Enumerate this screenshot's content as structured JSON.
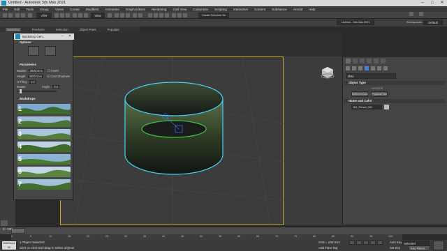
{
  "window": {
    "title": "Untitled - Autodesk 3ds Max 2021",
    "minimize": "–",
    "maximize": "□",
    "close": "✕"
  },
  "menu": [
    "File",
    "Edit",
    "Tools",
    "Group",
    "Views",
    "Create",
    "Modifiers",
    "Animation",
    "Graph Editors",
    "Rendering",
    "Civil View",
    "Customize",
    "Scripting",
    "Interactive",
    "Content",
    "Substance",
    "Arnold",
    "Help"
  ],
  "toolbar": {
    "view_dropdown": "View",
    "selection_set": "Create Selection Se",
    "user_box": "Libertos - 3ds Max 2021",
    "workspaces_label": "Workspaces:",
    "workspace_value": "Default"
  },
  "tabs": [
    "Modeling",
    "Freeform",
    "Selection",
    "Object Paint",
    "Populate"
  ],
  "viewport": {
    "label": "[+] [T",
    "accent": "#c9a623"
  },
  "float_panel": {
    "title": "Backdrop Gen...",
    "options_label": "Options",
    "parameters_label": "Parameters",
    "radius_label": "Radius",
    "radius_value": "3000.0cm",
    "invert_label": "Invert",
    "height_label": "Height",
    "height_value": "3000.0cm",
    "cast_shadows_label": "Cast Shadows",
    "ustiling_label": "U-Tiling",
    "ustiling_value": "1.0",
    "rotate_label": "Rotate",
    "angle_label": "Angle:",
    "angle_value": "0.0",
    "backdrops_label": "Backdrops",
    "backdrops": [
      "1",
      "2",
      "3",
      "4",
      "5",
      "6",
      "7"
    ]
  },
  "command_panel": {
    "category": "Misc",
    "object_type_label": "Object Type",
    "autogrid_label": "AutoGrid",
    "btn_dome": "BdDomeCam",
    "btn_physical": "PhysicalCam",
    "name_color_label": "Name and Color",
    "object_name": "BG_Preset_001"
  },
  "timeline": {
    "frame": "0 / 100",
    "ticks": [
      "0",
      "5",
      "10",
      "15",
      "20",
      "25",
      "30",
      "35",
      "40",
      "45",
      "50",
      "55",
      "60",
      "65",
      "70",
      "75",
      "80",
      "85",
      "90",
      "95",
      "100"
    ]
  },
  "status": {
    "selected": "1 Object Selected",
    "hint": "Click or click-and-drag to select objects",
    "grid": "Grid = 100.0cm",
    "add_time_tag": "Add Time Tag",
    "auto_key": "Auto Key",
    "selected_dropdown": "Selected",
    "set_key": "Set Key",
    "key_filters": "Key Filters...",
    "script_box": "MAXScript Mi"
  }
}
